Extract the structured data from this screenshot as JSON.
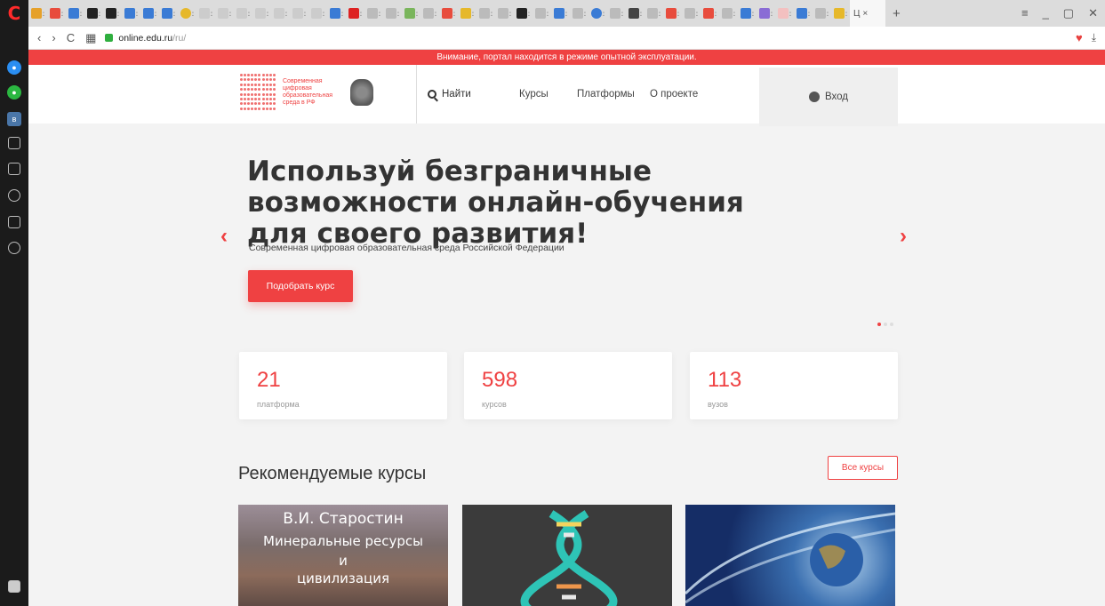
{
  "browser": {
    "url_host": "online.edu.ru",
    "url_path": "/ru/",
    "active_tab_title": "Ц"
  },
  "notice": "Внимание, портал находится в режиме опытной эксплуатации.",
  "header": {
    "logo_text": [
      "Современная",
      "цифровая",
      "образовательная",
      "среда в РФ"
    ],
    "search_label": "Найти",
    "nav": [
      "Курсы",
      "Платформы",
      "О проекте"
    ],
    "login_label": "Вход"
  },
  "hero": {
    "title": "Используй безграничные возможности онлайн-обучения для своего развития!",
    "subtitle": "Современная цифровая образовательная среда Российской Федерации",
    "cta_label": "Подобрать курс",
    "slides_total": 3,
    "slide_active": 1
  },
  "stats": [
    {
      "value": "21",
      "label": "платформа"
    },
    {
      "value": "598",
      "label": "курсов"
    },
    {
      "value": "113",
      "label": "вузов"
    }
  ],
  "recommended": {
    "title": "Рекомендуемые курсы",
    "all_label": "Все курсы",
    "cards": [
      {
        "image_text": [
          "В.И. Старостин",
          "Минеральные ресурсы",
          "и",
          "цивилизация"
        ]
      },
      {
        "image_text": []
      },
      {
        "image_text": []
      }
    ]
  },
  "colors": {
    "accent": "#ef4142",
    "sidebar": "#1b1b1b",
    "tabbar": "#dcdcdc"
  }
}
